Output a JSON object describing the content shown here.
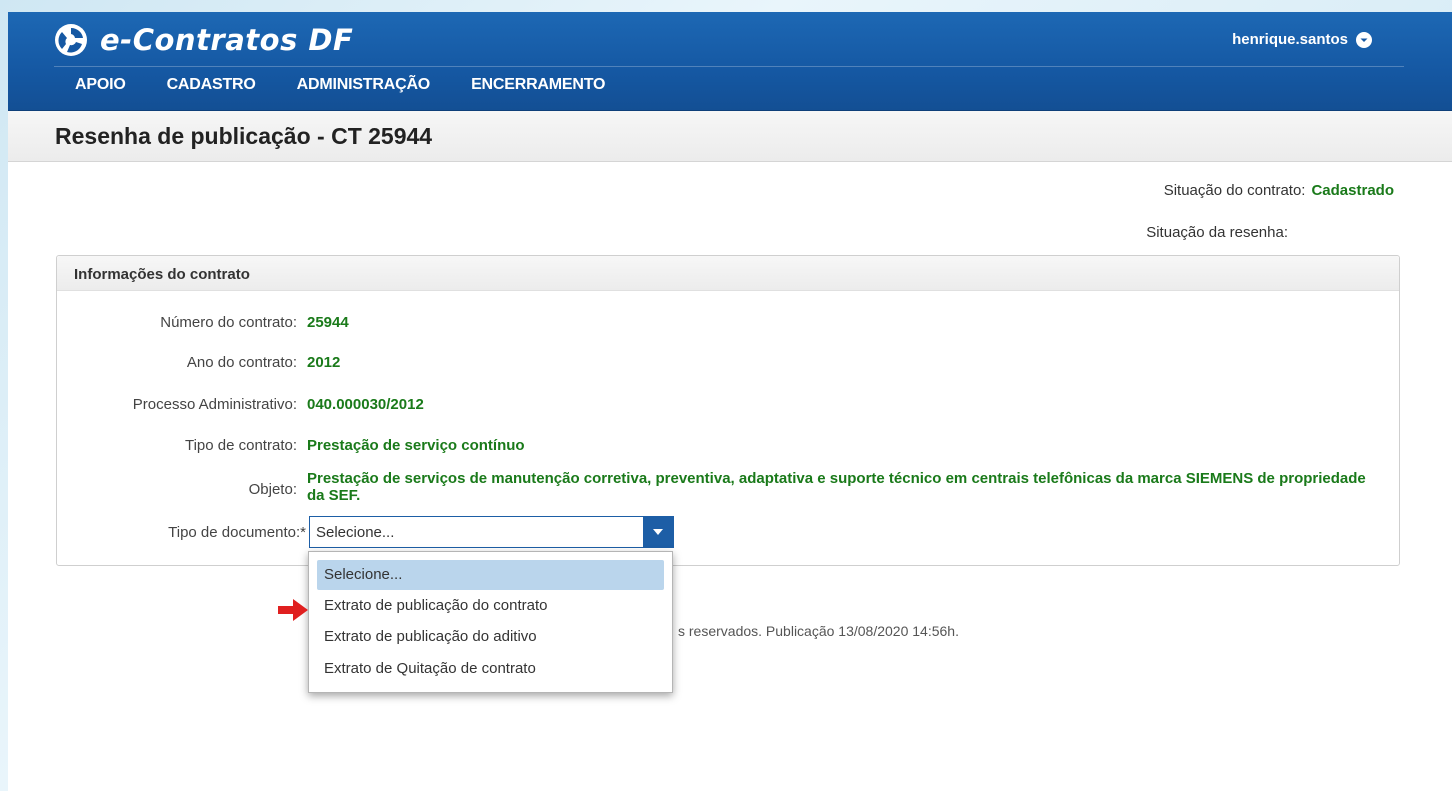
{
  "header": {
    "brand": "e-Contratos DF",
    "user": "henrique.santos",
    "nav": [
      "APOIO",
      "CADASTRO",
      "ADMINISTRAÇÃO",
      "ENCERRAMENTO"
    ]
  },
  "page": {
    "title": "Resenha de publicação - CT 25944"
  },
  "status": {
    "contract_label": "Situação do contrato:",
    "contract_value": "Cadastrado",
    "review_label": "Situação da resenha:",
    "review_value": ""
  },
  "panel": {
    "title": "Informações do contrato",
    "fields": [
      {
        "label": "Número do contrato:",
        "value": "25944"
      },
      {
        "label": "Ano do contrato:",
        "value": "2012"
      },
      {
        "label": "Processo Administrativo:",
        "value": "040.000030/2012"
      },
      {
        "label": "Tipo de contrato:",
        "value": "Prestação de serviço contínuo"
      },
      {
        "label": "Objeto:",
        "value": "Prestação de serviços de manutenção corretiva, preventiva, adaptativa e suporte técnico em centrais telefônicas da marca SIEMENS de propriedade da SEF."
      }
    ],
    "doc_type": {
      "label": "Tipo de documento:*",
      "selected": "Selecione..."
    }
  },
  "dropdown": {
    "options": [
      "Selecione...",
      "Extrato de publicação do contrato",
      "Extrato de publicação do aditivo",
      "Extrato de Quitação de contrato"
    ]
  },
  "footer": {
    "text": "s reservados. Publicação 13/08/2020 14:56h."
  },
  "colors": {
    "header_blue": "#1558a3",
    "value_green": "#1a7a1a",
    "highlight": "#bad5ec",
    "arrow_red": "#e02020"
  }
}
